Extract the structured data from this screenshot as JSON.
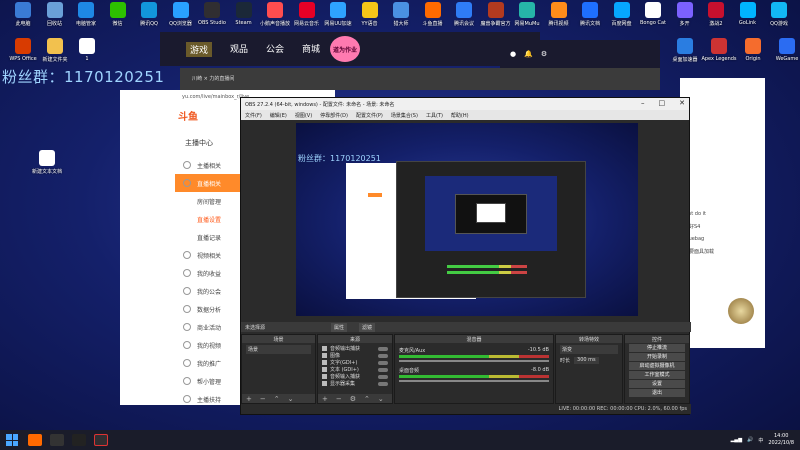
{
  "desktop": {
    "fans_text": "粉丝群：1170120251",
    "top_icons": [
      {
        "label": "此电脑",
        "color": "#3a7bd5"
      },
      {
        "label": "回收站",
        "color": "#6aa0d8"
      },
      {
        "label": "电脑管家",
        "color": "#1e88e5"
      },
      {
        "label": "微信",
        "color": "#2dc100"
      },
      {
        "label": "腾讯QQ",
        "color": "#1296db"
      },
      {
        "label": "QQ浏览器",
        "color": "#29a0ff"
      },
      {
        "label": "OBS Studio",
        "color": "#302e31"
      },
      {
        "label": "Steam",
        "color": "#1b2838"
      },
      {
        "label": "小鹅声音播放",
        "color": "#ff4d4f"
      },
      {
        "label": "网易云音乐",
        "color": "#e60026"
      },
      {
        "label": "网易UU加速",
        "color": "#2ea3ff"
      },
      {
        "label": "YY语音",
        "color": "#f5c518"
      },
      {
        "label": "猎大师",
        "color": "#4a90e2"
      },
      {
        "label": "斗鱼直播",
        "color": "#ff6a00"
      },
      {
        "label": "腾讯会议",
        "color": "#2f7cf6"
      },
      {
        "label": "魔兽争霸官方",
        "color": "#b33a1f"
      },
      {
        "label": "网易MuMu",
        "color": "#26b5a8"
      },
      {
        "label": "腾讯视频",
        "color": "#ff8c1a"
      },
      {
        "label": "腾讯文档",
        "color": "#1e6fff"
      },
      {
        "label": "百度网盘",
        "color": "#06a7ff"
      },
      {
        "label": "Bongo Cat",
        "color": "#ffffff"
      },
      {
        "label": "多开",
        "color": "#7b61ff"
      },
      {
        "label": "激战2",
        "color": "#c8102e"
      },
      {
        "label": "GoLink",
        "color": "#00b4ff"
      },
      {
        "label": "QQ游戏",
        "color": "#12b7f5"
      }
    ],
    "second_row_icons": [
      {
        "label": "WPS Office",
        "color": "#d83b01"
      },
      {
        "label": "新建文件夹",
        "color": "#f2c14e"
      },
      {
        "label": "1",
        "color": "#ffffff"
      }
    ],
    "right_icons": [
      {
        "label": "桌面加速器",
        "color": "#2a7de1"
      },
      {
        "label": "Apex Legends",
        "color": "#cd3333"
      },
      {
        "label": "Origin",
        "color": "#f56c2d"
      },
      {
        "label": "WeGame",
        "color": "#2b6cf2"
      }
    ],
    "left_doc_icon": "新建文本文档"
  },
  "launcher": {
    "nav": [
      "游戏",
      "观品",
      "公会",
      "商城"
    ],
    "brand": "道为作业"
  },
  "browser": {
    "tab": "川崎 ×   力的直播间",
    "address": "yu.com/live/mainbox_r/live",
    "logo": "斗鱼",
    "section_title": "主播中心",
    "menu": [
      {
        "label": "主播相关",
        "kind": "item",
        "active": false
      },
      {
        "label": "直播相关",
        "kind": "item",
        "active": true
      },
      {
        "label": "房间管理",
        "kind": "sub",
        "selected": false
      },
      {
        "label": "直播设置",
        "kind": "sub",
        "selected": true
      },
      {
        "label": "直播记录",
        "kind": "sub",
        "selected": false
      },
      {
        "label": "视频相关",
        "kind": "item",
        "active": false
      },
      {
        "label": "我的收益",
        "kind": "item",
        "active": false
      },
      {
        "label": "我的公会",
        "kind": "item",
        "active": false
      },
      {
        "label": "数据分析",
        "kind": "item",
        "active": false
      },
      {
        "label": "商业活动",
        "kind": "item",
        "active": false
      },
      {
        "label": "我的视频",
        "kind": "item",
        "active": false
      },
      {
        "label": "我的推广",
        "kind": "item",
        "active": false
      },
      {
        "label": "帮小管理",
        "kind": "item",
        "active": false
      },
      {
        "label": "主播扶持",
        "kind": "item",
        "active": false
      }
    ]
  },
  "chat": {
    "lines": [
      "Just do it",
      "你好S4",
      "bluebag",
      "不要面具加载"
    ]
  },
  "obs": {
    "title": "OBS 27.2.4 (64-bit, windows) - 配置文件: 未命名 - 场景: 未命名",
    "menu": [
      "文件(F)",
      "编辑(E)",
      "视图(V)",
      "停靠部件(D)",
      "配置文件(P)",
      "场景集合(S)",
      "工具(T)",
      "帮助(H)"
    ],
    "preview_text": "粉丝群：1170120251",
    "toolbar_label": "未选择源",
    "toolbar_buttons": [
      "属性",
      "滤镜"
    ],
    "docks": {
      "scenes": {
        "title": "场景",
        "items": [
          "场景"
        ]
      },
      "sources": {
        "title": "来源",
        "items": [
          "音频输出捕获",
          "图像",
          "文字(GDI+)",
          "文本 (GDI+)",
          "音频输入捕获",
          "显示器采集"
        ]
      },
      "mixer": {
        "title": "混音器",
        "tracks": [
          {
            "name": "麦克风/Aux",
            "db": "-10.5 dB"
          },
          {
            "name": "桌面音频",
            "db": "-8.0 dB"
          }
        ]
      },
      "transitions": {
        "title": "转场特效",
        "type": "渐变",
        "duration_label": "时长",
        "duration": "300 ms"
      },
      "controls": {
        "title": "控件",
        "buttons": [
          "停止推流",
          "开始录制",
          "启动虚拟摄像机",
          "工作室模式",
          "设置",
          "退出"
        ]
      }
    },
    "status": "LIVE: 00:00:00   REC: 00:00:00   CPU: 2.0%, 60.00 fps"
  },
  "taskbar": {
    "time": "14:00",
    "date": "2022/10/8"
  }
}
